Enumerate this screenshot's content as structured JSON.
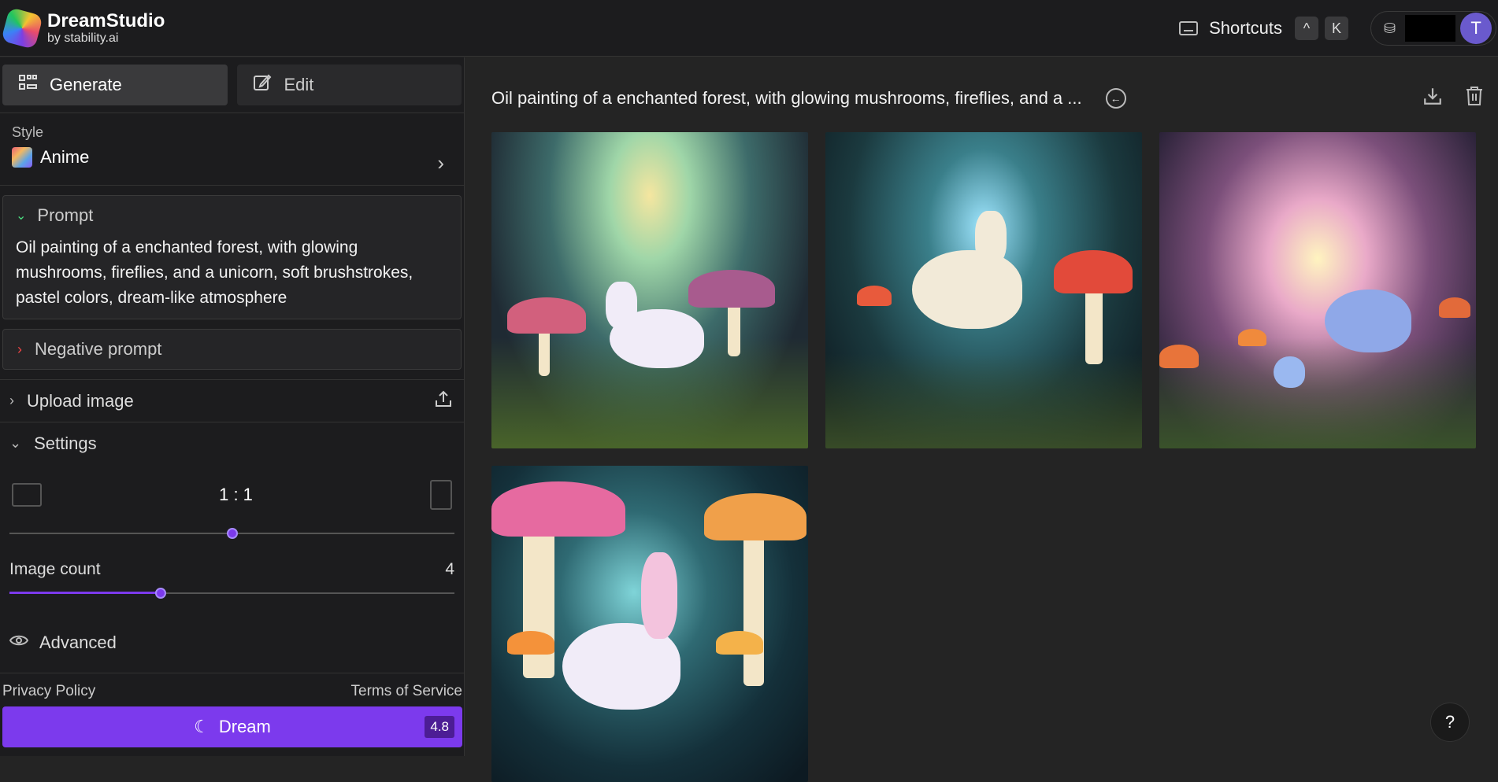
{
  "app": {
    "name": "DreamStudio",
    "byline": "by stability.ai"
  },
  "topbar": {
    "shortcuts_label": "Shortcuts",
    "key_ctrl": "^",
    "key_k": "K",
    "avatar_initial": "T"
  },
  "modes": [
    {
      "label": "Generate",
      "icon": "grid-icon",
      "active": true
    },
    {
      "label": "Edit",
      "icon": "edit-icon",
      "active": false
    }
  ],
  "style": {
    "section_label": "Style",
    "value": "Anime"
  },
  "prompt": {
    "header": "Prompt",
    "text": "Oil painting of a enchanted forest, with glowing mushrooms, fireflies, and a unicorn, soft brushstrokes, pastel colors, dream-like atmosphere"
  },
  "negative_prompt": {
    "header": "Negative prompt"
  },
  "upload": {
    "label": "Upload image"
  },
  "settings": {
    "label": "Settings",
    "aspect_ratio": "1 : 1",
    "aspect_position": 0.5,
    "image_count_label": "Image count",
    "image_count": "4",
    "image_count_fraction": 0.34,
    "advanced_label": "Advanced"
  },
  "footer": {
    "privacy": "Privacy Policy",
    "terms": "Terms of Service",
    "dream_label": "Dream",
    "credits": "4.8"
  },
  "main": {
    "title": "Oil painting of a enchanted forest, with glowing mushrooms, fireflies, and a ..."
  },
  "colors": {
    "accent": "#7c3aed",
    "background": "#242424",
    "panel": "#1c1c1e"
  }
}
